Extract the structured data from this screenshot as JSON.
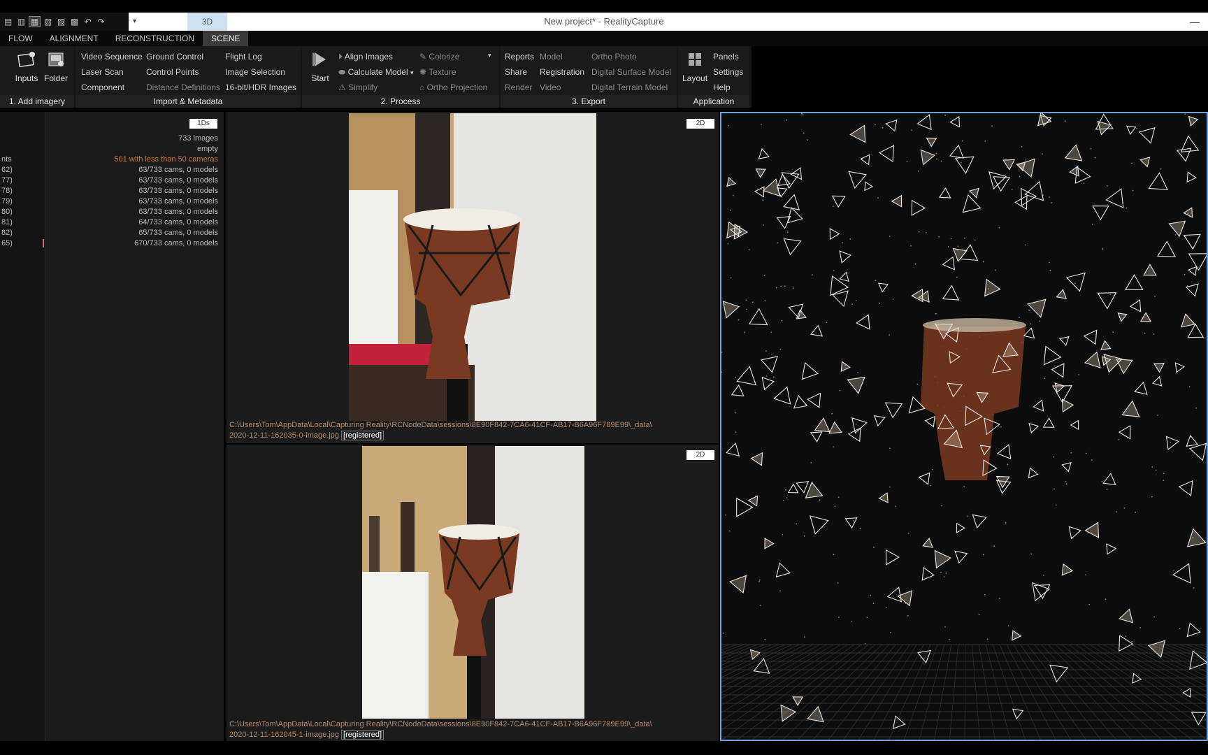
{
  "window": {
    "title": "New project* - RealityCapture",
    "view_mode": "3D",
    "minimize": "—"
  },
  "tabs": [
    {
      "label": "FLOW",
      "active": false
    },
    {
      "label": "ALIGNMENT",
      "active": false
    },
    {
      "label": "RECONSTRUCTION",
      "active": false
    },
    {
      "label": "SCENE",
      "active": true
    }
  ],
  "ribbon": {
    "add_imagery": {
      "label": "1. Add imagery",
      "inputs": "Inputs",
      "folder": "Folder"
    },
    "import": {
      "label": "Import & Metadata",
      "items": [
        "Video Sequence",
        "Laser Scan",
        "Component",
        "Ground Control",
        "Control Points",
        "Distance Definitions",
        "Flight Log",
        "Image Selection",
        "16-bit/HDR Images"
      ]
    },
    "process": {
      "label": "2. Process",
      "start": "Start",
      "align": "Align Images",
      "calculate": "Calculate Model",
      "simplify": "Simplify",
      "colorize": "Colorize",
      "texture": "Texture",
      "ortho": "Ortho Projection"
    },
    "export": {
      "label": "3. Export",
      "items": [
        "Reports",
        "Share",
        "Render",
        "Model",
        "Registration",
        "Video",
        "Ortho Photo",
        "Digital Surface Model",
        "Digital Terrain Model"
      ]
    },
    "application": {
      "label": "Application",
      "layout": "Layout",
      "panels": "Panels",
      "settings": "Settings",
      "help": "Help"
    }
  },
  "left_panel": {
    "tag": "1Ds",
    "summary": [
      "733 images",
      "empty",
      "501 with less than 50 cameras"
    ],
    "ids": [
      "nts",
      "62)",
      "77)",
      "78)",
      "79)",
      "80)",
      "81)",
      "82)",
      "65)"
    ],
    "components": [
      "63/733 cams, 0 models",
      "63/733 cams, 0 models",
      "63/733 cams, 0 models",
      "63/733 cams, 0 models",
      "63/733 cams, 0 models",
      "64/733 cams, 0 models",
      "65/733 cams, 0 models",
      "670/733 cams, 0 models"
    ]
  },
  "viewer_top": {
    "tag": "2D",
    "path": "C:\\Users\\Tom\\AppData\\Local\\Capturing Reality\\RCNodeData\\sessions\\8E90F842-7CA6-41CF-AB17-B6A96F789E99\\_data\\",
    "file": "2020-12-11-162035-0-image.jpg",
    "status": "[registered]"
  },
  "viewer_bottom": {
    "tag": "2D",
    "path": "C:\\Users\\Tom\\AppData\\Local\\Capturing Reality\\RCNodeData\\sessions\\8E90F842-7CA6-41CF-AB17-B6A96F789E99\\_data\\",
    "file": "2020-12-11-162045-1-image.jpg",
    "status": "[registered]"
  },
  "colors": {
    "accent": "#6fa0d8",
    "warning": "#c8763a",
    "drum_body": "#7a3a22",
    "drum_head": "#f2ede4"
  },
  "icons": [
    "layout-icon",
    "undo-icon",
    "redo-icon",
    "inputs-icon",
    "folder-icon",
    "start-icon",
    "align-icon",
    "colorize-icon",
    "texture-icon",
    "simplify-icon",
    "calculate-icon",
    "layout-grid-icon"
  ]
}
